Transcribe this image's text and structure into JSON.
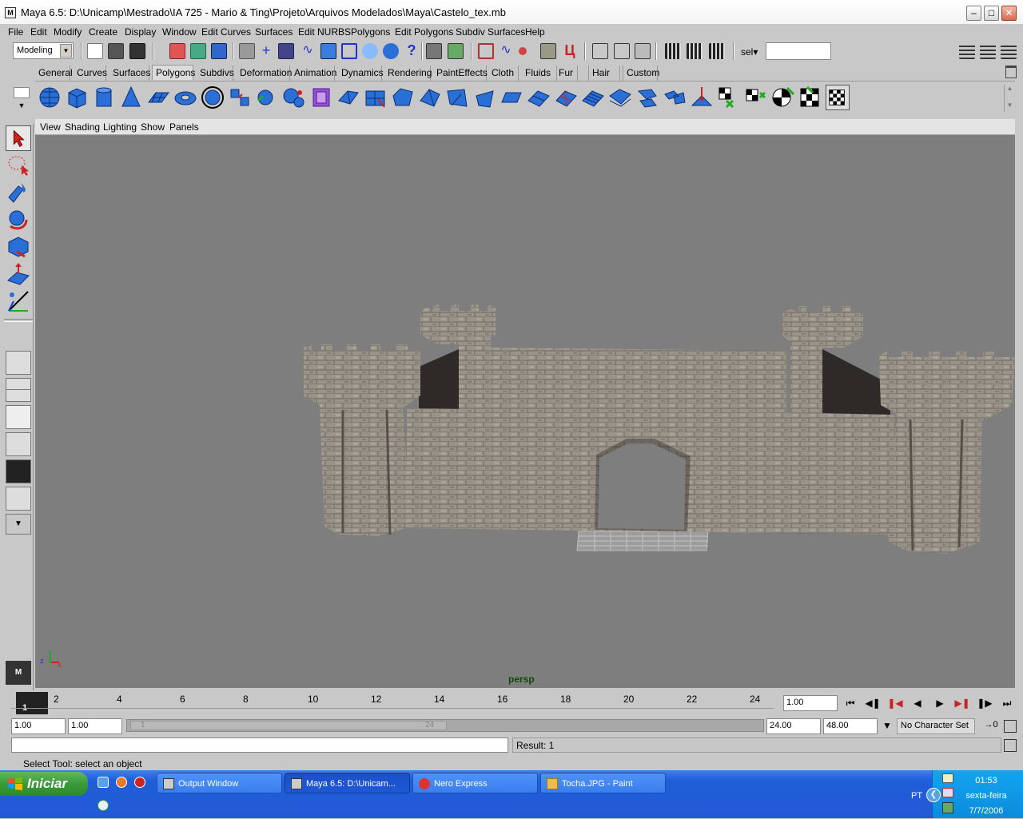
{
  "window": {
    "title": "Maya 6.5: D:\\Unicamp\\Mestrado\\IA 725 - Mario & Ting\\Projeto\\Arquivos Modelados\\Maya\\Castelo_tex.mb",
    "app_icon": "M"
  },
  "menubar": {
    "items": [
      "File",
      "Edit",
      "Modify",
      "Create",
      "Display",
      "Window",
      "Edit Curves",
      "Surfaces",
      "Edit NURBS",
      "Polygons",
      "Edit Polygons",
      "Subdiv Surfaces",
      "Help"
    ]
  },
  "statusline": {
    "mode": "Modeling",
    "sel_label": "sel▾",
    "sel_value": ""
  },
  "shelf": {
    "tabs": [
      "General",
      "Curves",
      "Surfaces",
      "Polygons",
      "Subdivs",
      "Deformation",
      "Animation",
      "Dynamics",
      "Rendering",
      "PaintEffects",
      "Cloth",
      "Fluids",
      "Fur",
      "Hair",
      "Custom"
    ],
    "active_tab": "Polygons"
  },
  "panel": {
    "menu": [
      "View",
      "Shading",
      "Lighting",
      "Show",
      "Panels"
    ],
    "camera": "persp",
    "axis_labels": {
      "z": "z",
      "x": "x"
    }
  },
  "timeline": {
    "ticks": [
      "2",
      "4",
      "6",
      "8",
      "10",
      "12",
      "14",
      "16",
      "18",
      "20",
      "22",
      "24"
    ],
    "current_frame_marker": "1",
    "current_time": "1.00"
  },
  "range": {
    "start_time": "1.00",
    "playback_start": "1.00",
    "slider_start": "1",
    "slider_end": "24",
    "playback_end": "24.00",
    "end_time": "48.00",
    "character_set": "No Character Set"
  },
  "commandline": {
    "input": "",
    "result": "Result: 1"
  },
  "helpline": {
    "text": "Select Tool: select an object"
  },
  "taskbar": {
    "start_label": "Iniciar",
    "tasks": [
      {
        "label": "Output Window",
        "active": false
      },
      {
        "label": "Maya 6.5: D:\\Unicam...",
        "active": true
      },
      {
        "label": "Nero Express",
        "active": false
      },
      {
        "label": "Tocha.JPG - Paint",
        "active": false
      }
    ],
    "language": "PT",
    "time": "01:53",
    "weekday": "sexta-feira",
    "date": "7/7/2006"
  },
  "colors": {
    "viewport_bg": "#7e7e7e",
    "ui_bg": "#c8c8c8",
    "taskbar_blue": "#2458d6",
    "start_green": "#3a9a3a",
    "camera_label": "#0a4a0a"
  }
}
